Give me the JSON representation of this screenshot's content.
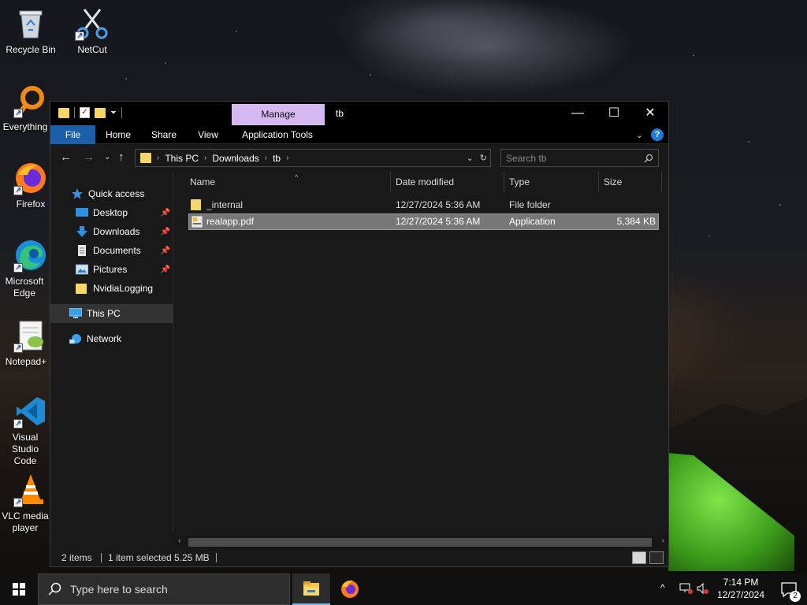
{
  "desktop": {
    "icons": [
      {
        "label": "Recycle Bin",
        "icon": "recycle-bin-icon"
      },
      {
        "label": "NetCut",
        "icon": "scissors-icon"
      },
      {
        "label": "Everything",
        "icon": "magnifier-icon"
      },
      {
        "label": "Firefox",
        "icon": "firefox-icon"
      },
      {
        "label": "Microsoft Edge",
        "icon": "edge-icon"
      },
      {
        "label": "Notepad+",
        "icon": "notepad-plus-icon"
      },
      {
        "label": "Visual Studio Code",
        "icon": "vscode-icon"
      },
      {
        "label": "VLC media player",
        "icon": "vlc-cone-icon"
      }
    ]
  },
  "window": {
    "title": "tb",
    "context_tab": "Manage",
    "ribbon_tabs": [
      "File",
      "Home",
      "Share",
      "View",
      "Application Tools"
    ],
    "caption": {
      "minimize": "—",
      "maximize": "☐",
      "close": "✕"
    },
    "address": {
      "crumbs": [
        "This PC",
        "Downloads",
        "tb"
      ]
    },
    "search_placeholder": "Search tb",
    "nav_pane": [
      {
        "label": "Quick access",
        "icon": "star-icon",
        "pinned": false
      },
      {
        "label": "Desktop",
        "icon": "desktop-icon",
        "pinned": true
      },
      {
        "label": "Downloads",
        "icon": "download-arrow-icon",
        "pinned": true
      },
      {
        "label": "Documents",
        "icon": "document-icon",
        "pinned": true
      },
      {
        "label": "Pictures",
        "icon": "picture-icon",
        "pinned": true
      },
      {
        "label": "NvidiaLogging",
        "icon": "folder-icon",
        "pinned": false
      },
      {
        "label": "This PC",
        "icon": "computer-icon",
        "pinned": false
      },
      {
        "label": "Network",
        "icon": "network-icon",
        "pinned": false
      }
    ],
    "columns": [
      "Name",
      "Date modified",
      "Type",
      "Size"
    ],
    "files": [
      {
        "name": "_internal",
        "date": "12/27/2024 5:36 AM",
        "type": "File folder",
        "size": "",
        "icon": "folder-icon"
      },
      {
        "name": "realapp.pdf",
        "date": "12/27/2024 5:36 AM",
        "type": "Application",
        "size": "5,384 KB",
        "icon": "application-icon"
      }
    ],
    "status": {
      "items": "2 items",
      "selection": "1 item selected",
      "size": "5.25 MB"
    }
  },
  "taskbar": {
    "search_placeholder": "Type here to search",
    "clock_time": "7:14 PM",
    "clock_date": "12/27/2024",
    "notification_count": "2"
  },
  "colors": {
    "accent": "#1a5fa8",
    "manage_tab": "#d5b8ef",
    "folder": "#f6d56b"
  }
}
